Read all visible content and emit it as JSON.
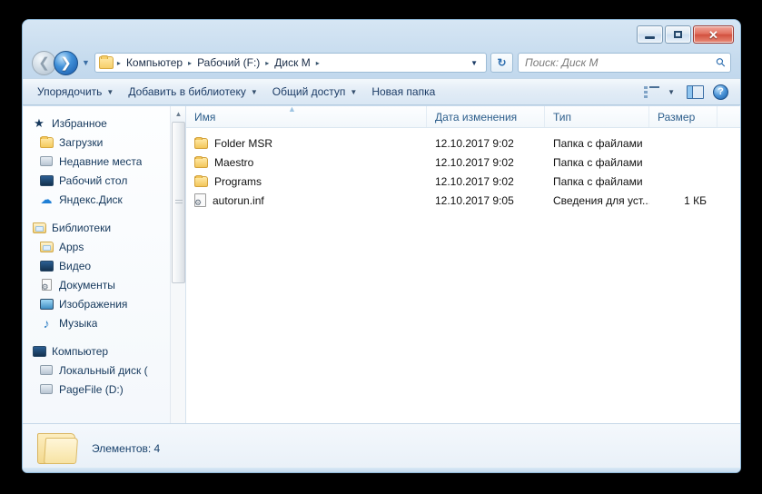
{
  "window": {
    "controls": {
      "minimize": "Minimize",
      "maximize": "Maximize",
      "close": "Close"
    }
  },
  "address": {
    "back_label": "Назад",
    "forward_label": "Вперед",
    "history_label": "Последние страницы",
    "folder_icon": "folder-icon",
    "crumbs": [
      "Компьютер",
      "Рабочий (F:)",
      "Диск М"
    ],
    "separator": "▸",
    "dropdown": "▼",
    "refresh_label": "Обновить"
  },
  "search": {
    "placeholder": "Поиск: Диск М",
    "icon": "search-icon"
  },
  "toolbar": {
    "organize": "Упорядочить",
    "add_to_library": "Добавить в библиотеку",
    "share": "Общий доступ",
    "new_folder": "Новая папка",
    "caret": "▼",
    "view_label": "Изменить представление",
    "preview_label": "Область просмотра",
    "help_label": "Справка",
    "help_glyph": "?"
  },
  "sidebar": {
    "groups": [
      {
        "header": {
          "label": "Избранное",
          "icon": "star-icon"
        },
        "items": [
          {
            "label": "Загрузки",
            "icon": "downloads-folder-icon"
          },
          {
            "label": "Недавние места",
            "icon": "recent-places-icon"
          },
          {
            "label": "Рабочий стол",
            "icon": "desktop-icon"
          },
          {
            "label": "Яндекс.Диск",
            "icon": "yandex-disk-icon"
          }
        ]
      },
      {
        "header": {
          "label": "Библиотеки",
          "icon": "libraries-icon"
        },
        "items": [
          {
            "label": "Apps",
            "icon": "apps-library-icon"
          },
          {
            "label": "Видео",
            "icon": "video-library-icon"
          },
          {
            "label": "Документы",
            "icon": "documents-library-icon"
          },
          {
            "label": "Изображения",
            "icon": "pictures-library-icon"
          },
          {
            "label": "Музыка",
            "icon": "music-library-icon"
          }
        ]
      },
      {
        "header": {
          "label": "Компьютер",
          "icon": "computer-icon"
        },
        "items": [
          {
            "label": "Локальный диск (",
            "icon": "local-disk-icon"
          },
          {
            "label": "PageFile (D:)",
            "icon": "drive-icon"
          }
        ]
      }
    ],
    "scroll_up": "▲",
    "scroll_down": "▼"
  },
  "filelist": {
    "columns": {
      "name": "Имя",
      "date": "Дата изменения",
      "type": "Тип",
      "size": "Размер"
    },
    "sort_indicator": "▲",
    "rows": [
      {
        "name": "Folder MSR",
        "date": "12.10.2017 9:02",
        "type": "Папка с файлами",
        "size": "",
        "icon": "folder-icon"
      },
      {
        "name": "Maestro",
        "date": "12.10.2017 9:02",
        "type": "Папка с файлами",
        "size": "",
        "icon": "folder-icon"
      },
      {
        "name": "Programs",
        "date": "12.10.2017 9:02",
        "type": "Папка с файлами",
        "size": "",
        "icon": "folder-icon"
      },
      {
        "name": "autorun.inf",
        "date": "12.10.2017 9:05",
        "type": "Сведения для уст...",
        "size": "1 КБ",
        "icon": "inf-file-icon"
      }
    ]
  },
  "statusbar": {
    "items_text": "Элементов: 4",
    "folder_icon": "open-folder-icon"
  }
}
